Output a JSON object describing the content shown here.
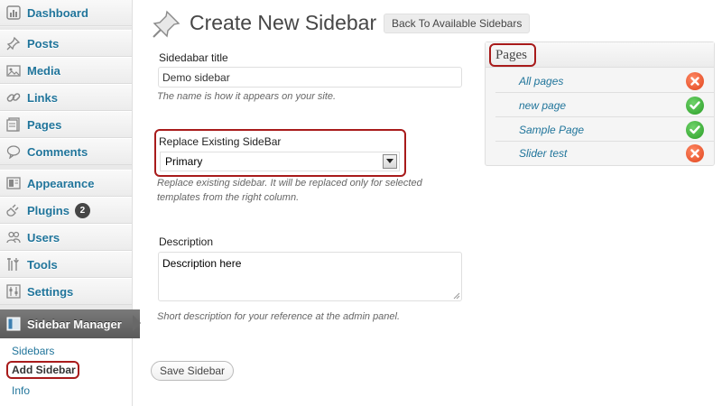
{
  "sidebar": {
    "items": [
      {
        "label": "Dashboard",
        "icon": "dashboard-icon"
      },
      {
        "label": "Posts",
        "icon": "pin-icon"
      },
      {
        "label": "Media",
        "icon": "media-icon"
      },
      {
        "label": "Links",
        "icon": "link-icon"
      },
      {
        "label": "Pages",
        "icon": "page-icon"
      },
      {
        "label": "Comments",
        "icon": "comment-icon"
      },
      {
        "label": "Appearance",
        "icon": "appearance-icon"
      },
      {
        "label": "Plugins",
        "icon": "plug-icon",
        "badge": "2"
      },
      {
        "label": "Users",
        "icon": "users-icon"
      },
      {
        "label": "Tools",
        "icon": "tools-icon"
      },
      {
        "label": "Settings",
        "icon": "settings-icon"
      }
    ],
    "current": {
      "label": "Sidebar Manager",
      "icon": "sidebar-manager-icon"
    },
    "submenu": [
      {
        "label": "Sidebars"
      },
      {
        "label": "Add Sidebar"
      },
      {
        "label": "Info"
      }
    ]
  },
  "header": {
    "title": "Create New Sidebar",
    "back_button": "Back To Available Sidebars"
  },
  "form": {
    "title_label": "Sidedabar title",
    "title_value": "Demo sidebar",
    "title_help": "The name is how it appears on your site.",
    "replace_label": "Replace Existing SideBar",
    "replace_value": "Primary",
    "replace_help_1": "Replace existing sidebar. It will be replaced only for selected",
    "replace_help_2": "templates from the right column.",
    "description_label": "Description",
    "description_value": "Description here",
    "description_help": "Short description for your reference at the admin panel.",
    "save_button": "Save Sidebar"
  },
  "pages_panel": {
    "title": "Pages",
    "rows": [
      {
        "label": "All pages",
        "status": "off"
      },
      {
        "label": "new page",
        "status": "on"
      },
      {
        "label": "Sample Page",
        "status": "on"
      },
      {
        "label": "Slider test",
        "status": "off"
      }
    ]
  },
  "colors": {
    "link": "#21759b",
    "highlight": "#a81b1b",
    "status_on": "#2a9d26",
    "status_off": "#e0431b"
  }
}
